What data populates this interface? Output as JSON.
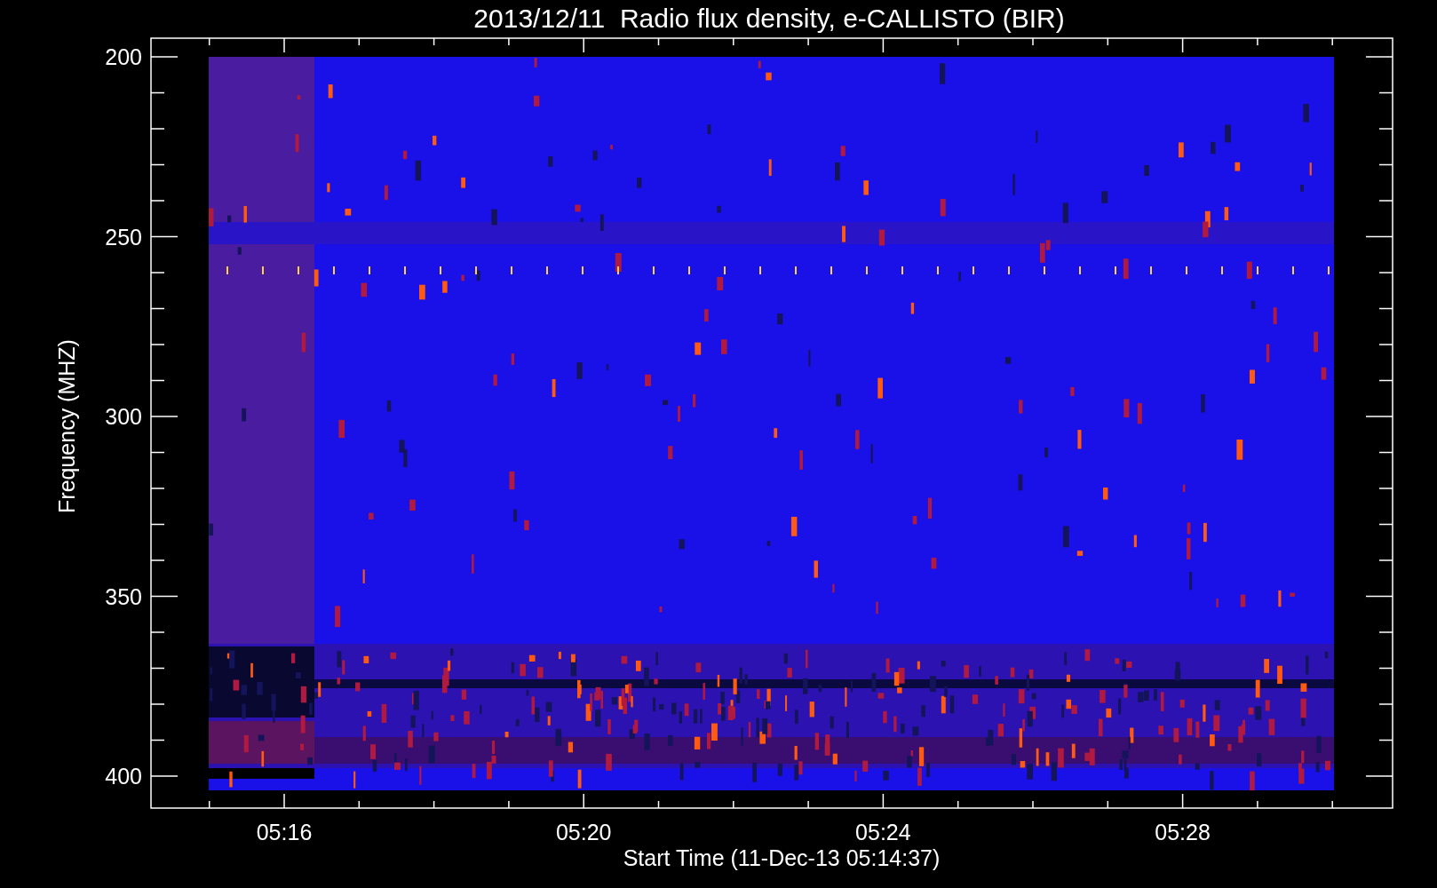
{
  "title": "2013/12/11  Radio flux density, e-CALLISTO (BIR)",
  "y_axis": {
    "label": "Frequency (MHZ)",
    "ticks": [
      "200",
      "250",
      "300",
      "350",
      "400"
    ]
  },
  "x_axis": {
    "label": "Start Time (11-Dec-13 05:14:37)",
    "ticks": [
      "05:16",
      "05:20",
      "05:24",
      "05:28"
    ]
  }
}
